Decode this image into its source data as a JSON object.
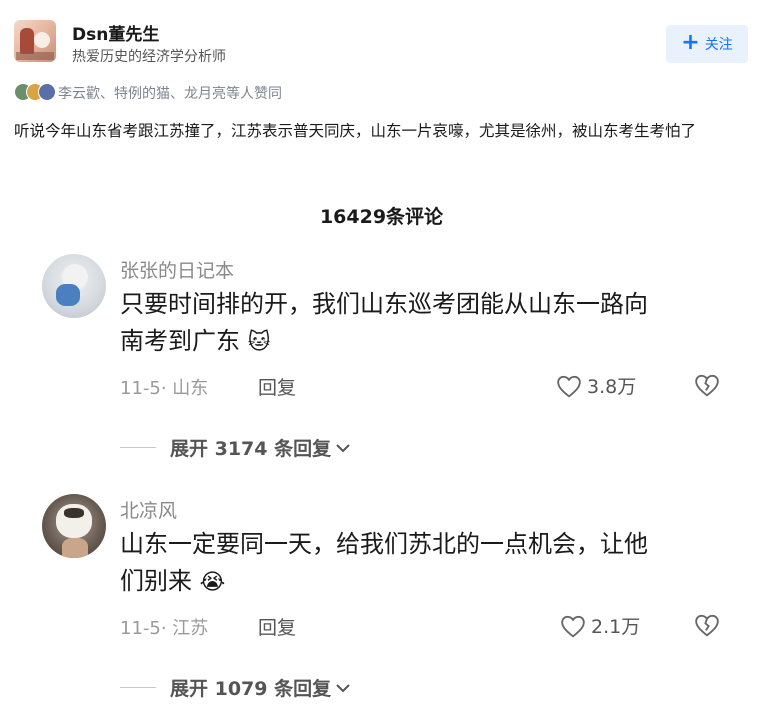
{
  "author": {
    "name": "Dsn董先生",
    "bio": "热爱历史的经济学分析师",
    "follow_label": "关注"
  },
  "likers_text": "李云歡、特例的猫、龙月亮等人赞同",
  "post_text": "听说今年山东省考跟江苏撞了，江苏表示普天同庆，山东一片哀嚎，尤其是徐州，被山东考生考怕了",
  "comment_count": "16429条评论",
  "comments": [
    {
      "user": "张张的日记本",
      "line1": "只要时间排的开，我们山东巡考团能从山东一路向",
      "line2": "南考到广东",
      "date_loc": "11-5· 山东",
      "reply_label": "回复",
      "likes": "3.8万",
      "expand": "展开 3174 条回复"
    },
    {
      "user": "北凉风",
      "line1": "山东一定要同一天，给我们苏北的一点机会，让他",
      "line2": "们别来",
      "date_loc": "11-5· 江苏",
      "reply_label": "回复",
      "likes": "2.1万",
      "expand": "展开 1079 条回复"
    }
  ],
  "colors": {
    "accent": "#1772f6",
    "follow_bg": "#e9f1fd",
    "muted": "#8a8a8a"
  },
  "icons": [
    "plus-icon",
    "heart-icon",
    "broken-heart-icon",
    "chevron-down-icon",
    "cat-emoji-icon",
    "crying-emoji-icon"
  ]
}
